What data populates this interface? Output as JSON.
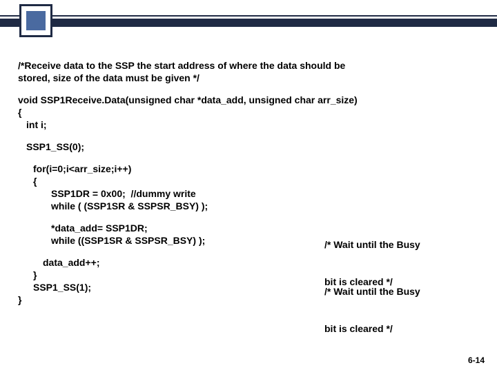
{
  "header_comment_line1": "/*Receive data to the SSP the start address of where the data should be",
  "header_comment_line2": "stored, size of the data must be given */",
  "fn_decl": "void SSP1Receive.Data(unsigned char *data_add, unsigned char arr_size)",
  "brace_open": "{",
  "var_decl": "int i;",
  "ss_low": "SSP1_SS(0);",
  "for_line": "for(i=0;i<arr_size;i++)",
  "for_brace": "{",
  "dummy_write": "SSP1DR = 0x00;  //dummy write",
  "wait1": "while ( (SSP1SR & SSPSR_BSY) );",
  "read_line": "*data_add= SSP1DR;",
  "wait2": "while ((SSP1SR & SSPSR_BSY) );",
  "inc_line": "data_add++;",
  "for_close": "}",
  "ss_high": "SSP1_SS(1);",
  "brace_close": "}",
  "note_busy_l1": "/* Wait until the Busy",
  "note_busy_l2": "bit is cleared */",
  "page_number": "6-14"
}
